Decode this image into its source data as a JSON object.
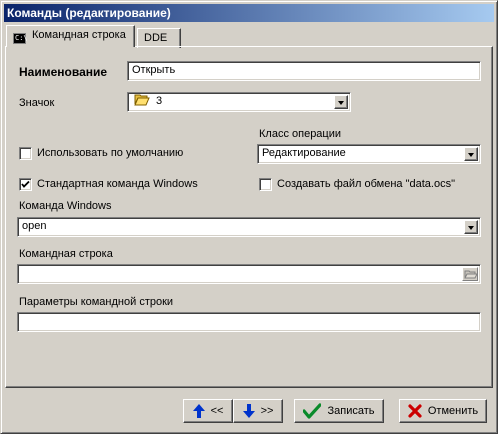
{
  "window": {
    "title": "Команды (редактирование)"
  },
  "tabs": [
    {
      "label": "Командная строка",
      "icon": "command-prompt-icon",
      "active": true
    },
    {
      "label": "DDE",
      "active": false
    }
  ],
  "form": {
    "name_label": "Наименование",
    "name_value": "Открыть",
    "icon_label": "Значок",
    "icon_value": "3",
    "icon_glyph": "open-folder-icon",
    "use_default_label": "Использовать по умолчанию",
    "use_default_checked": false,
    "op_class_label": "Класс операции",
    "op_class_value": "Редактирование",
    "std_cmd_label": "Стандартная команда Windows",
    "std_cmd_checked": true,
    "create_file_label": "Создавать файл обмена \"data.ocs\"",
    "create_file_checked": false,
    "win_cmd_label": "Команда Windows",
    "win_cmd_value": "open",
    "cmdline_label": "Командная строка",
    "cmdline_value": "",
    "params_label": "Параметры командной строки",
    "params_value": ""
  },
  "buttons": {
    "prev_label": "<<",
    "next_label": ">>",
    "save_label": "Записать",
    "cancel_label": "Отменить"
  },
  "colors": {
    "title_start": "#0a246a",
    "title_end": "#a6caf0",
    "face": "#d4d0c8",
    "arrow_blue": "#0033cc",
    "save_green": "#0a8a2a",
    "cancel_red": "#cc0000"
  }
}
